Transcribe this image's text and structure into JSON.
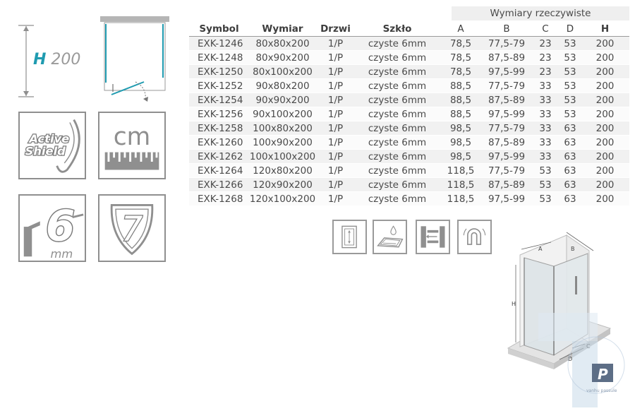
{
  "height_badge": {
    "letter": "H",
    "value": "200"
  },
  "tiles": {
    "active_shield": {
      "line1": "Active",
      "line2": "Shield"
    },
    "cm": {
      "label": "cm"
    },
    "glass_thickness": {
      "value": "6",
      "unit": "mm"
    },
    "warranty": {
      "years": "7"
    }
  },
  "table": {
    "super_header": "Wymiary rzeczywiste",
    "columns": [
      "Symbol",
      "Wymiar",
      "Drzwi",
      "Szkło",
      "A",
      "B",
      "C",
      "D",
      "H"
    ],
    "rows": [
      [
        "EXK-1246",
        "80x80x200",
        "1/P",
        "czyste 6mm",
        "78,5",
        "77,5-79",
        "23",
        "53",
        "200"
      ],
      [
        "EXK-1248",
        "80x90x200",
        "1/P",
        "czyste 6mm",
        "78,5",
        "87,5-89",
        "23",
        "53",
        "200"
      ],
      [
        "EXK-1250",
        "80x100x200",
        "1/P",
        "czyste 6mm",
        "78,5",
        "97,5-99",
        "23",
        "53",
        "200"
      ],
      [
        "EXK-1252",
        "90x80x200",
        "1/P",
        "czyste 6mm",
        "88,5",
        "77,5-79",
        "33",
        "53",
        "200"
      ],
      [
        "EXK-1254",
        "90x90x200",
        "1/P",
        "czyste 6mm",
        "88,5",
        "87,5-89",
        "33",
        "53",
        "200"
      ],
      [
        "EXK-1256",
        "90x100x200",
        "1/P",
        "czyste 6mm",
        "88,5",
        "97,5-99",
        "33",
        "53",
        "200"
      ],
      [
        "EXK-1258",
        "100x80x200",
        "1/P",
        "czyste 6mm",
        "98,5",
        "77,5-79",
        "33",
        "63",
        "200"
      ],
      [
        "EXK-1260",
        "100x90x200",
        "1/P",
        "czyste 6mm",
        "98,5",
        "87,5-89",
        "33",
        "63",
        "200"
      ],
      [
        "EXK-1262",
        "100x100x200",
        "1/P",
        "czyste 6mm",
        "98,5",
        "97,5-99",
        "33",
        "63",
        "200"
      ],
      [
        "EXK-1264",
        "120x80x200",
        "1/P",
        "czyste 6mm",
        "118,5",
        "77,5-79",
        "53",
        "63",
        "200"
      ],
      [
        "EXK-1266",
        "120x90x200",
        "1/P",
        "czyste 6mm",
        "118,5",
        "87,5-89",
        "53",
        "63",
        "200"
      ],
      [
        "EXK-1268",
        "120x100x200",
        "1/P",
        "czyste 6mm",
        "118,5",
        "97,5-99",
        "53",
        "63",
        "200"
      ]
    ]
  },
  "diagram_labels": {
    "a": "A",
    "b": "B",
    "c": "C",
    "d": "D",
    "h": "H"
  },
  "watermark": {
    "letter": "P",
    "text": "vanhu passule"
  },
  "colors": {
    "accent_teal": "#1f9bb0",
    "icon_gray": "#8f8f8f"
  }
}
